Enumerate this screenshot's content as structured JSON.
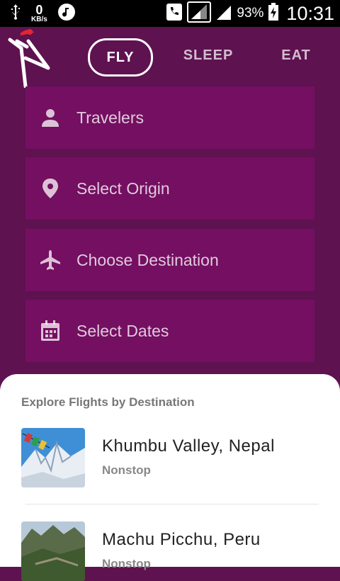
{
  "status_bar": {
    "net_speed_value": "0",
    "net_speed_unit": "KB/s",
    "battery_percent": "93%",
    "time": "10:31"
  },
  "tabs": [
    {
      "label": "FLY",
      "active": true
    },
    {
      "label": "SLEEP",
      "active": false
    },
    {
      "label": "EAT",
      "active": false
    }
  ],
  "fields": [
    {
      "label": "Travelers",
      "icon": "person-icon"
    },
    {
      "label": "Select Origin",
      "icon": "location-pin-icon"
    },
    {
      "label": "Choose Destination",
      "icon": "airplane-icon"
    },
    {
      "label": "Select Dates",
      "icon": "calendar-icon"
    }
  ],
  "explore": {
    "title": "Explore Flights by Destination",
    "destinations": [
      {
        "name": "Khumbu Valley, Nepal",
        "subtitle": "Nonstop"
      },
      {
        "name": "Machu Picchu, Peru",
        "subtitle": "Nonstop"
      }
    ]
  },
  "colors": {
    "background": "#5e1250",
    "field": "#740f61",
    "accent_red": "#e3262f"
  }
}
